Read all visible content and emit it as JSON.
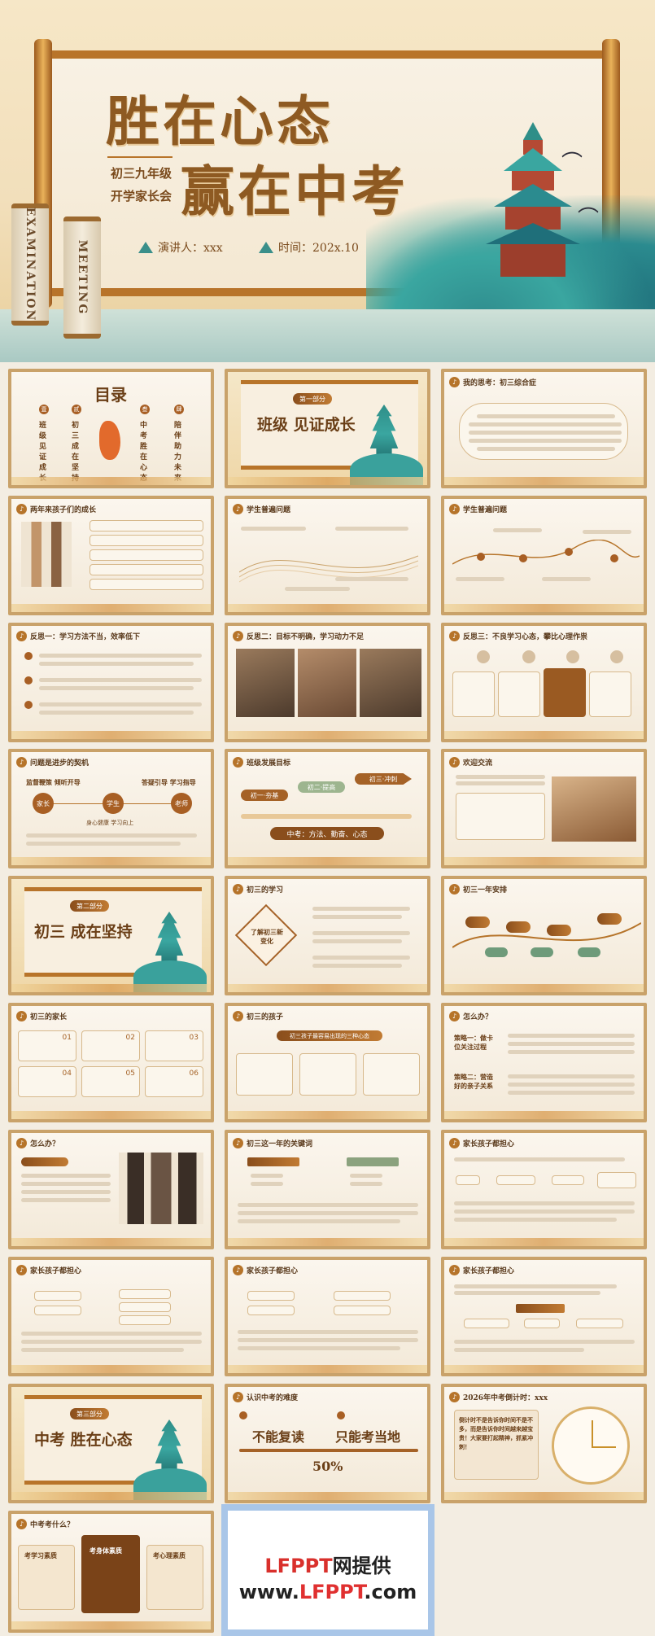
{
  "hero": {
    "title_line1": "胜在心态",
    "title_line2": "赢在中考",
    "subtitle1": "初三九年级",
    "subtitle2": "开学家长会",
    "speaker": "演讲人：xxx",
    "time": "时间：202x.10",
    "scroll_left": "EXAMINATION",
    "scroll_right": "MEETING"
  },
  "slides": {
    "toc": {
      "title": "目录",
      "items": [
        "班级 见证成长",
        "初三 成在坚持",
        "中考 胜在心态",
        "陪伴 助力未来"
      ],
      "badges": [
        "壹",
        "贰",
        "叁",
        "肆"
      ]
    },
    "s1_section": {
      "badge": "第一部分",
      "title": "班级 见证成长"
    },
    "s_think": {
      "title": "我的思考：初三综合症"
    },
    "s_growth": {
      "title": "两年来孩子们的成长"
    },
    "s_issue1": {
      "title": "学生普遍问题"
    },
    "s_issue2": {
      "title": "学生普遍问题"
    },
    "s_reflect1": {
      "title": "反思一：学习方法不当，效率低下"
    },
    "s_reflect2": {
      "title": "反思二：目标不明确，学习动力不足"
    },
    "s_reflect3": {
      "title": "反思三：不良学习心态，攀比心理作祟"
    },
    "s_progress": {
      "title": "问题是进步的契机",
      "roles": [
        "家长",
        "学生",
        "老师"
      ],
      "caption_left": "监督鞭策 倾听开导",
      "caption_right": "答疑引导 学习指导",
      "caption_mid": "身心健康 学习向上"
    },
    "s_goal": {
      "title": "班级发展目标",
      "banner": "中考：方法、勤奋、心态",
      "steps": [
        "初一·夯基",
        "初二·提高",
        "初三·冲刺"
      ]
    },
    "s_welcome": {
      "title": "欢迎交流"
    },
    "s2_section": {
      "badge": "第二部分",
      "title": "初三 成在坚持"
    },
    "s_learn": {
      "title": "初三的学习",
      "center": "了解初三新变化"
    },
    "s_plan": {
      "title": "初三一年安排"
    },
    "s_parents": {
      "title": "初三的家长",
      "cards": [
        "01",
        "02",
        "03",
        "04",
        "05",
        "06"
      ]
    },
    "s_kids": {
      "title": "初三的孩子",
      "banner": "初三孩子最容易出现的三种心态"
    },
    "s_how1": {
      "title": "怎么办？",
      "strategy1": "策略一：做卡位关注过程",
      "strategy2": "策略二：营造好的亲子关系"
    },
    "s_how2": {
      "title": "怎么办？"
    },
    "s_key": {
      "title": "初三这一年的关键词"
    },
    "s_together1": {
      "title": "家长孩子都担心"
    },
    "s_together2": {
      "title": "家长孩子都担心"
    },
    "s_together3": {
      "title": "家长孩子都担心"
    },
    "s_together4": {
      "title": "家长孩子都担心"
    },
    "s3_section": {
      "badge": "第三部分",
      "title": "中考 胜在心态"
    },
    "s_exam": {
      "title": "认识中考的难度",
      "left": "不能复读",
      "right": "只能考当地",
      "percent": "50%"
    },
    "s_countdown": {
      "title": "2026年中考倒计时：xxx",
      "text": "倒计时不是告诉你时间不是不多，而是告诉你时间越来越宝贵！大家要打起精神，抓紧冲刺！"
    },
    "s_what": {
      "title": "中考考什么？",
      "cards": [
        "考学习素质",
        "考身体素质",
        "考心理素质"
      ]
    }
  },
  "ad": {
    "line1_red": "LFPPT",
    "line1_black": "网提供",
    "line2_black": "www.",
    "line2_red": "LFPPT",
    "line2_tail": ".com"
  }
}
